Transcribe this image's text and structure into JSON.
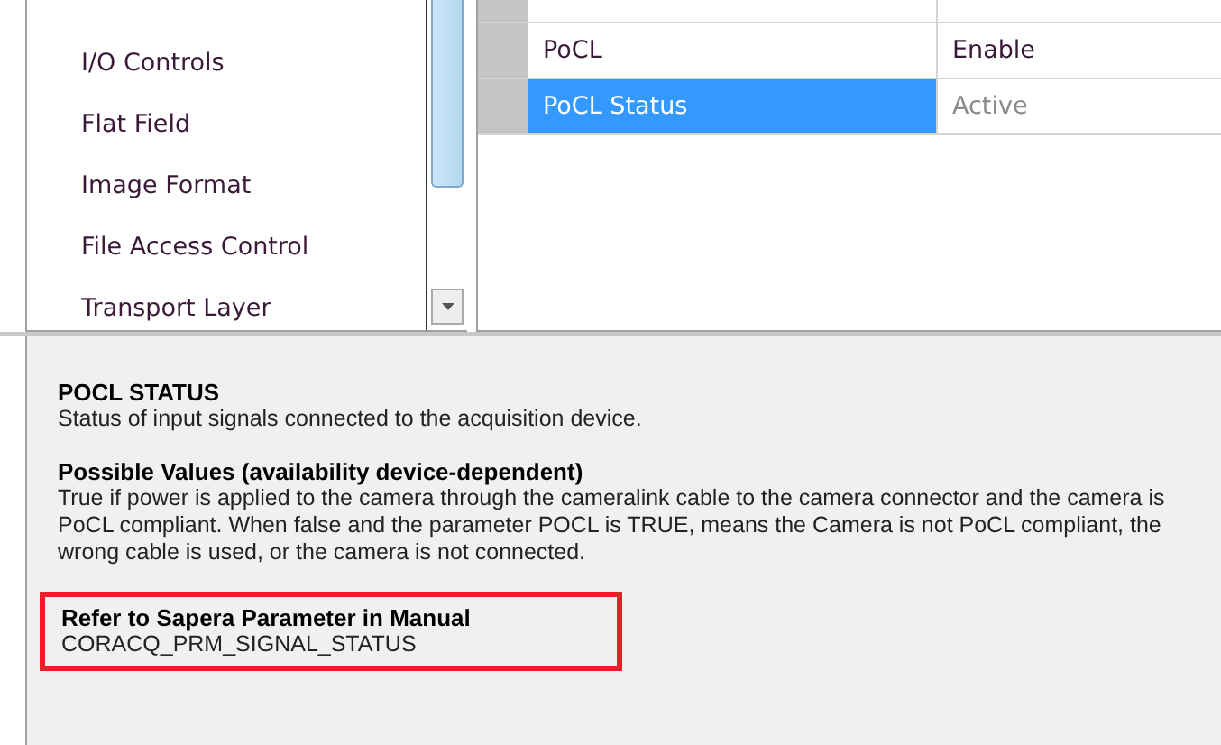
{
  "categories": [
    {
      "label": "I/O Controls"
    },
    {
      "label": "Flat Field"
    },
    {
      "label": "Image Format"
    },
    {
      "label": "File Access Control"
    },
    {
      "label": "Transport Layer"
    }
  ],
  "parameters": [
    {
      "name": "PoCL",
      "value": "Enable",
      "selected": false,
      "disabled": false
    },
    {
      "name": "PoCL Status",
      "value": "Active",
      "selected": true,
      "disabled": true
    }
  ],
  "description": {
    "title": "POCL STATUS",
    "summary": "Status of input signals connected to the acquisition device.",
    "values_heading": "Possible Values (availability device-dependent)",
    "values_text": "True if power is applied to the camera through the cameralink cable to the camera connector and the camera is PoCL compliant. When false and the parameter POCL is TRUE, means the Camera is not PoCL compliant, the wrong cable is used, or the camera is not connected.",
    "reference_heading": "Refer to Sapera Parameter in Manual",
    "reference_value": "CORACQ_PRM_SIGNAL_STATUS"
  }
}
